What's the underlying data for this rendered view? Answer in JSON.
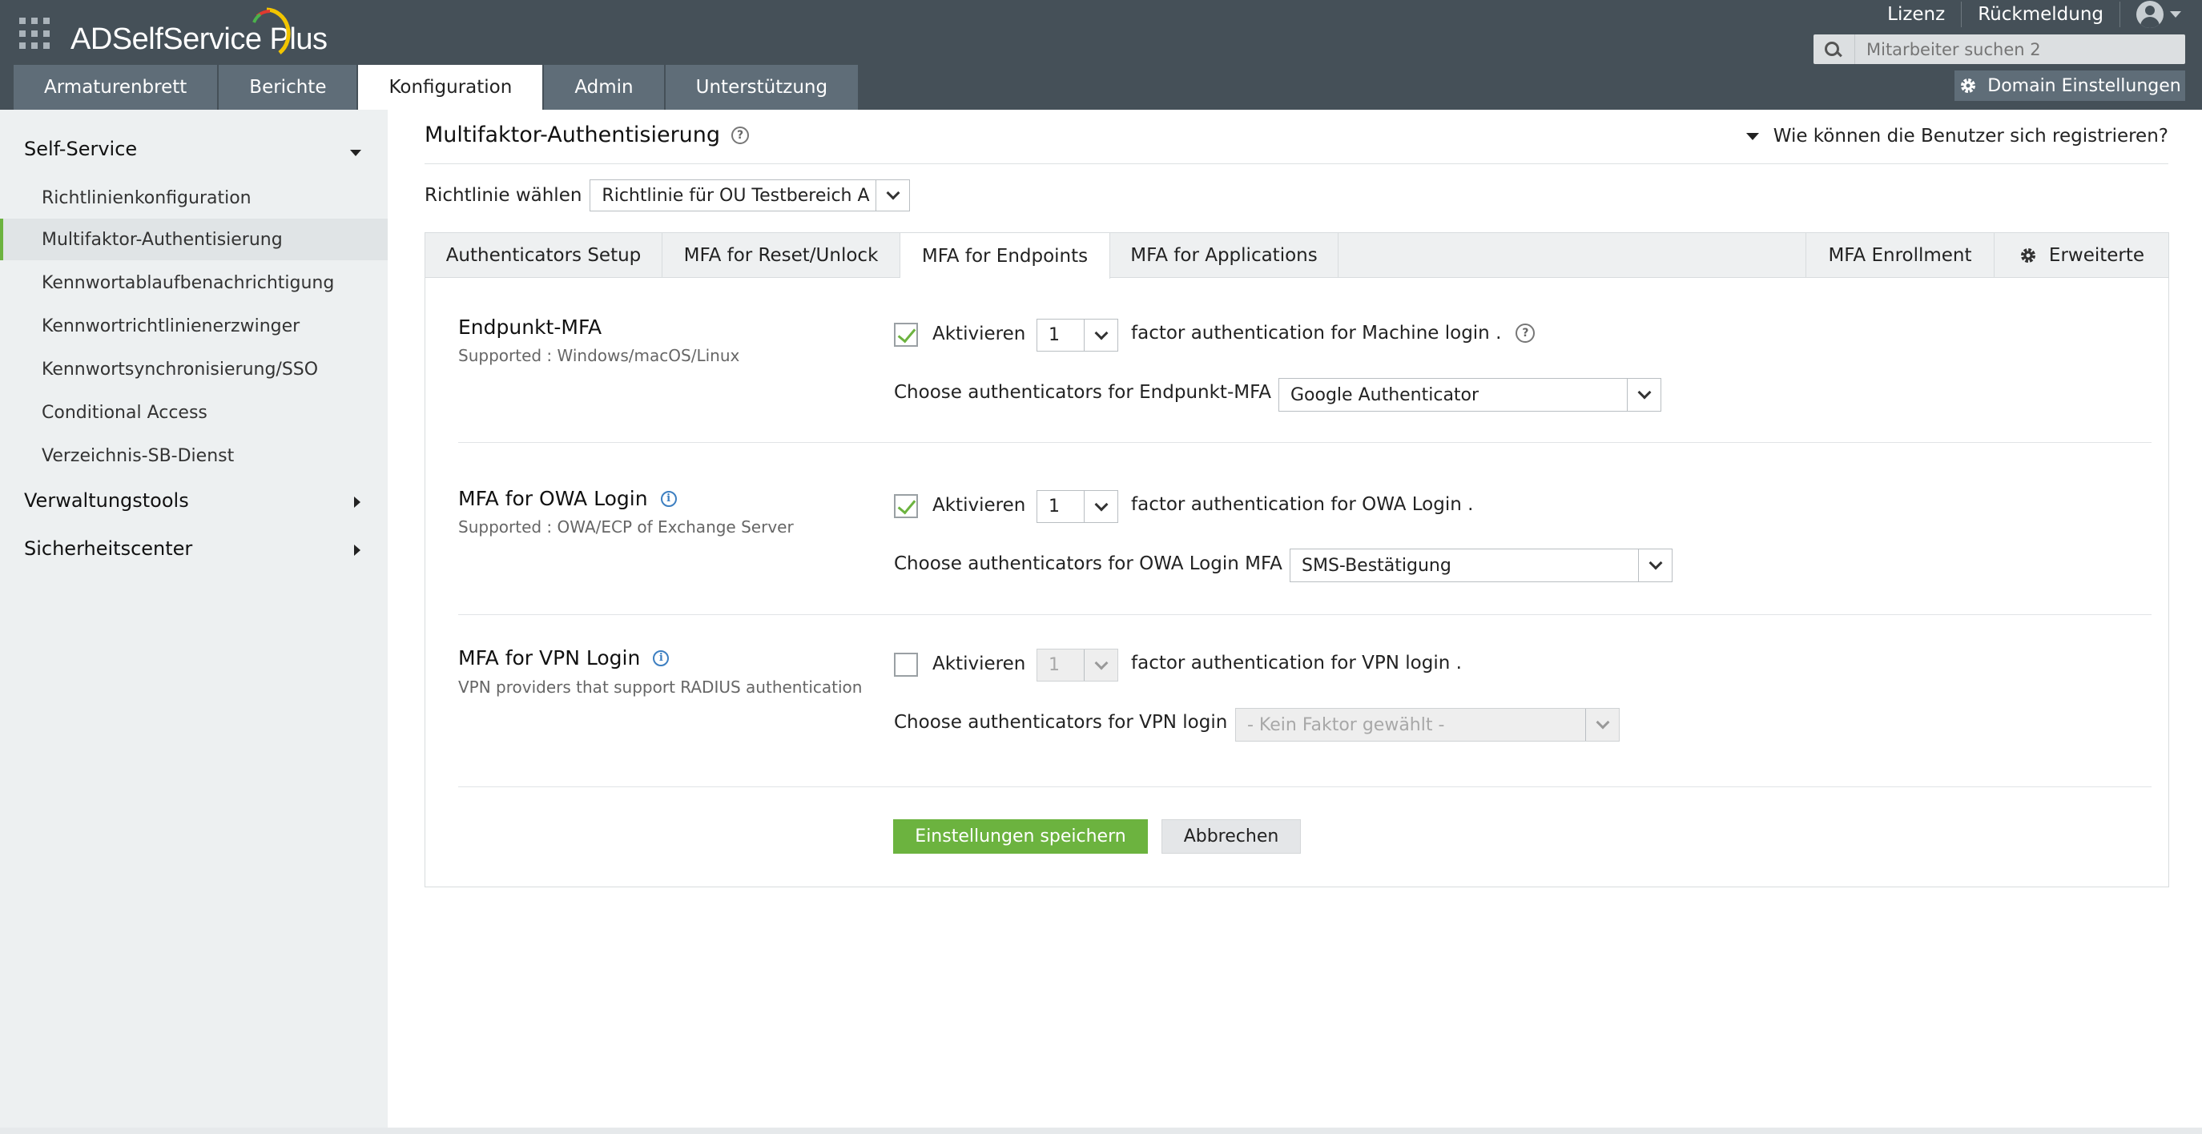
{
  "app": {
    "brand": "ADSelfService Plus"
  },
  "header": {
    "links": [
      "Lizenz",
      "Rückmeldung"
    ],
    "search_placeholder": "Mitarbeiter suchen 2",
    "nav_tabs": [
      "Armaturenbrett",
      "Berichte",
      "Konfiguration",
      "Admin",
      "Unterstützung"
    ],
    "active_tab": "Konfiguration",
    "domain_button": "Domain Einstellungen"
  },
  "sidebar": {
    "self_service": "Self-Service",
    "items": [
      "Richtlinienkonfiguration",
      "Multifaktor-Authentisierung",
      "Kennwortablaufbenachrichtigung",
      "Kennwortrichtlinienerzwinger",
      "Kennwortsynchronisierung/SSO",
      "Conditional Access",
      "Verzeichnis-SB-Dienst"
    ],
    "active_item": "Multifaktor-Authentisierung",
    "admin_tools": "Verwaltungstools",
    "security_center": "Sicherheitscenter"
  },
  "main": {
    "title": "Multifaktor-Authentisierung",
    "register_link": "Wie können die Benutzer sich registrieren?",
    "policy_label": "Richtlinie wählen",
    "policy_value": "Richtlinie für OU Testbereich A",
    "subtabs": [
      "Authenticators Setup",
      "MFA for Reset/Unlock",
      "MFA for Endpoints",
      "MFA for Applications"
    ],
    "active_subtab": "MFA for Endpoints",
    "subtabs_right": [
      "MFA Enrollment",
      "Erweiterte"
    ],
    "sections": [
      {
        "title": "Endpunkt-MFA",
        "subtitle": "Supported : Windows/macOS/Linux",
        "enabled": true,
        "enable_label": "Aktivieren",
        "factor_count": "1",
        "factor_text": "factor authentication for Machine login .",
        "choose_label": "Choose authenticators for Endpunkt-MFA",
        "authenticator": "Google Authenticator"
      },
      {
        "title": "MFA for OWA Login",
        "subtitle": "Supported : OWA/ECP of Exchange Server",
        "enabled": true,
        "enable_label": "Aktivieren",
        "factor_count": "1",
        "factor_text": "factor authentication for OWA Login .",
        "choose_label": "Choose authenticators for OWA Login MFA",
        "authenticator": "SMS-Bestätigung"
      },
      {
        "title": "MFA for VPN Login",
        "subtitle": "VPN providers that support RADIUS authentication",
        "enabled": false,
        "enable_label": "Aktivieren",
        "factor_count": "1",
        "factor_text": "factor authentication for VPN login .",
        "choose_label": "Choose authenticators for VPN login",
        "authenticator": "- Kein Faktor gewählt -"
      }
    ],
    "save_button": "Einstellungen speichern",
    "cancel_button": "Abbrechen"
  },
  "colors": {
    "header_bg": "#455058",
    "tab_bg": "#5f6d78",
    "accent_green": "#6cb33f",
    "sidebar_bg": "#edf0f1",
    "info_blue": "#3d7fc1"
  },
  "icons": [
    "apps-grid-icon",
    "user-avatar-icon",
    "search-icon",
    "gear-icon",
    "help-icon",
    "info-icon",
    "chevron-down-icon",
    "caret-right-icon",
    "check-icon"
  ]
}
